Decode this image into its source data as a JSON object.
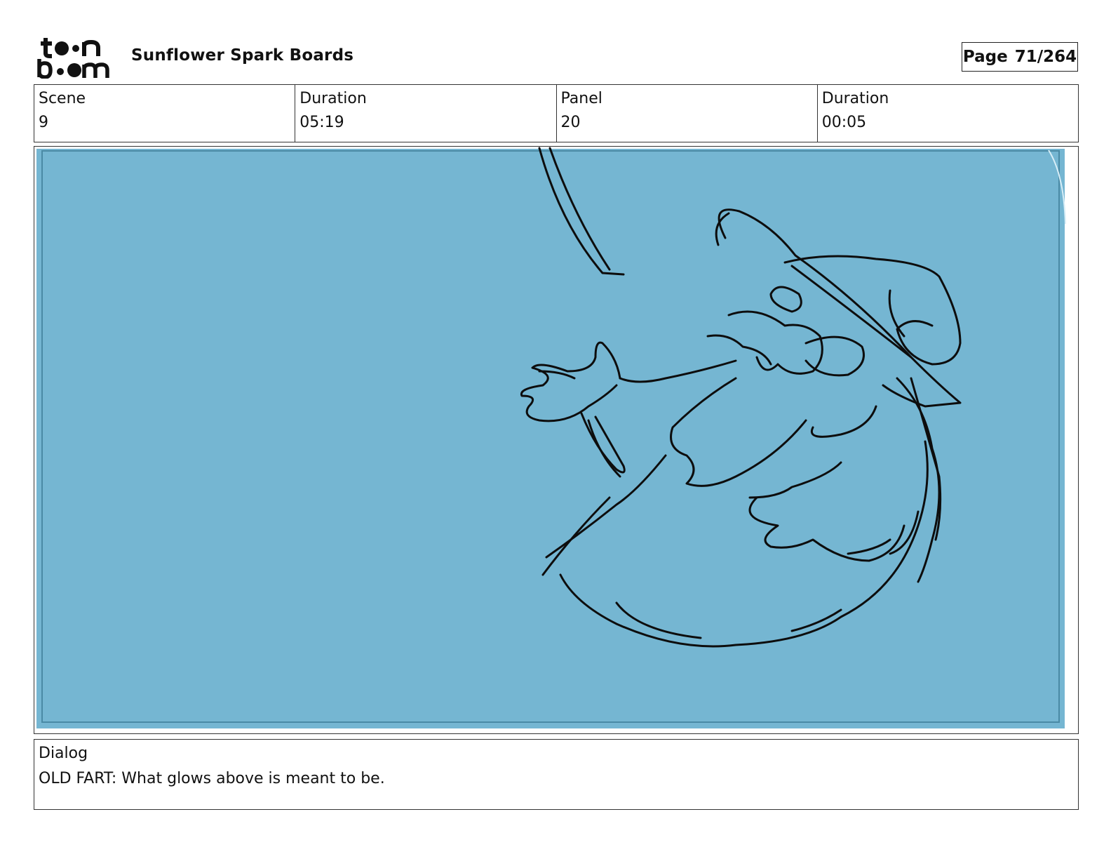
{
  "header": {
    "logo_text": "toon boom",
    "project_title": "Sunflower Spark Boards",
    "page_label": "Page",
    "page_number": "71/264"
  },
  "info": {
    "scene_label": "Scene",
    "scene_value": "9",
    "scene_duration_label": "Duration",
    "scene_duration_value": "05:19",
    "panel_label": "Panel",
    "panel_value": "20",
    "panel_duration_label": "Duration",
    "panel_duration_value": "00:05"
  },
  "panel": {
    "background_color": "#75b6d2",
    "line_color": "#0d0d0d"
  },
  "dialog": {
    "label": "Dialog",
    "text": "OLD FART: What glows above is meant to be."
  }
}
